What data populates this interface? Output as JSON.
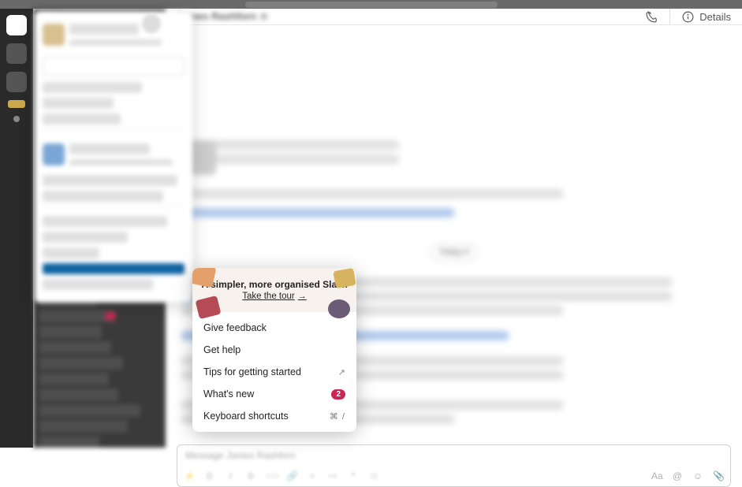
{
  "header": {
    "details_label": "Details"
  },
  "composer": {
    "placeholder": "Message James Rashforn"
  },
  "popover": {
    "banner_title": "A simpler, more organised Slack",
    "banner_link": "Take the tour",
    "items": {
      "feedback": "Give feedback",
      "help": "Get help",
      "tips": "Tips for getting started",
      "whatsnew": "What's new",
      "whatsnew_badge": "2",
      "shortcuts": "Keyboard shortcuts",
      "shortcuts_key": "⌘ /"
    }
  }
}
